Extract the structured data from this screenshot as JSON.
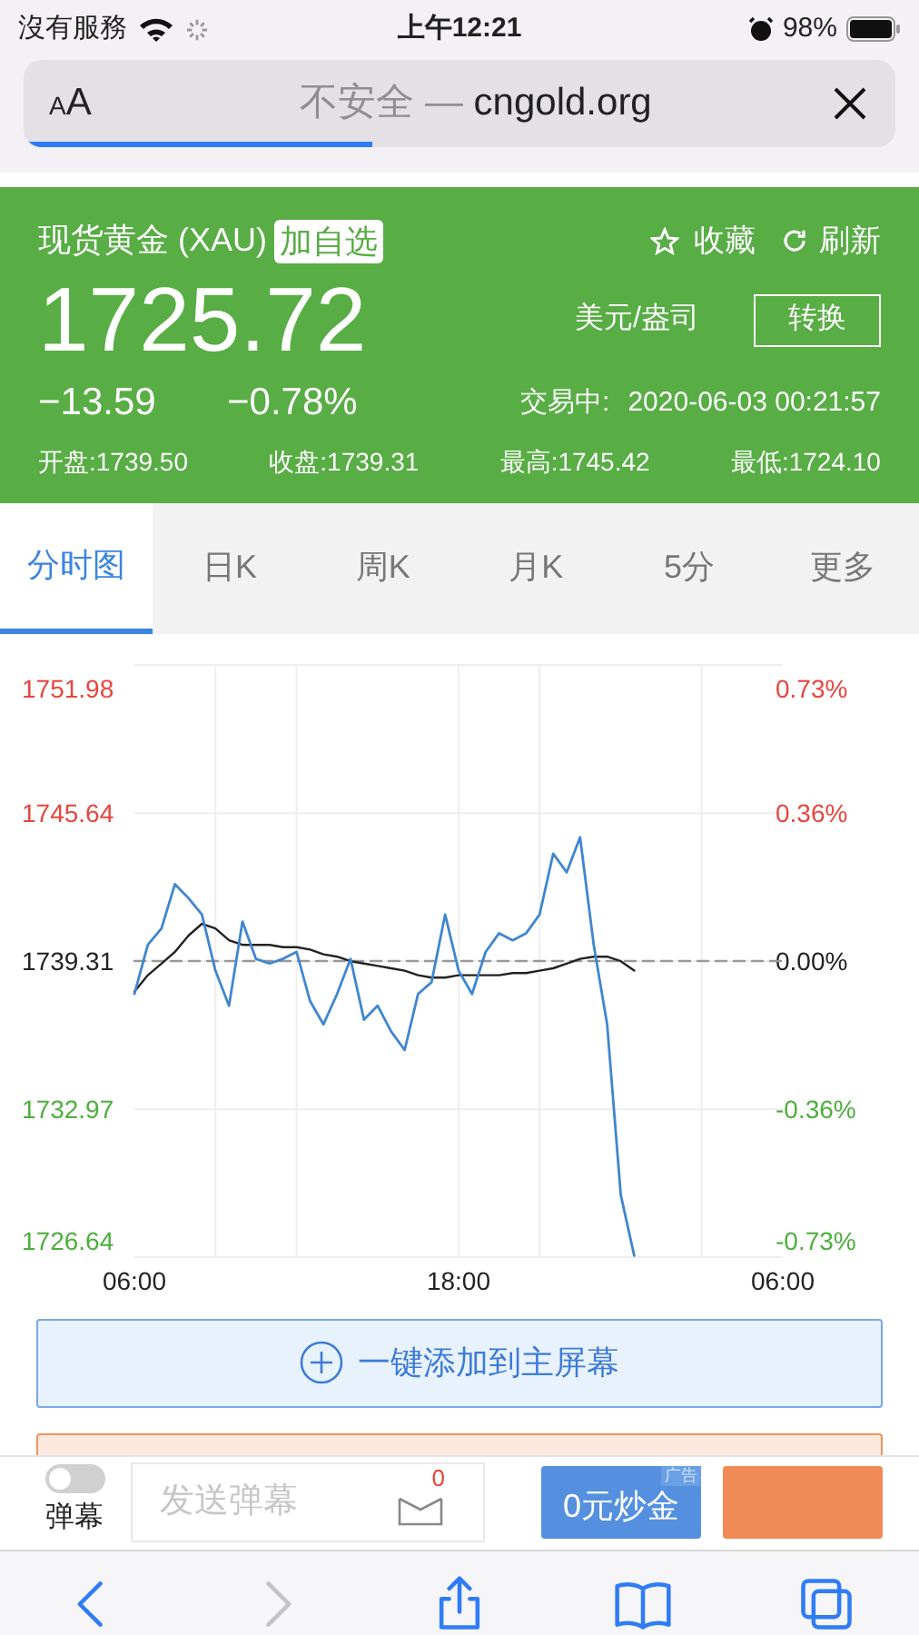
{
  "status_bar": {
    "carrier": "沒有服務",
    "time": "上午12:21",
    "battery": "98%"
  },
  "address_bar": {
    "text_size_small": "A",
    "text_size_large": "A",
    "security_note": "不安全 —",
    "domain": "cngold.org",
    "level": 0.4
  },
  "quote": {
    "name": "现货黄金 (XAU)",
    "add_watchlist": "加自选",
    "favorite": "收藏",
    "refresh": "刷新",
    "price": "1725.72",
    "unit": "美元/盎司",
    "convert": "转换",
    "change": "−13.59",
    "change_percent": "−0.78%",
    "status": "交易中:",
    "datetime": "2020-06-03 00:21:57",
    "stats": [
      {
        "label": "开盘:",
        "value": "1739.50"
      },
      {
        "label": "收盘:",
        "value": "1739.31"
      },
      {
        "label": "最高:",
        "value": "1745.42"
      },
      {
        "label": "最低:",
        "value": "1724.10"
      }
    ]
  },
  "tabs": [
    {
      "label": "分时图",
      "selected": true
    },
    {
      "label": "日K",
      "selected": false
    },
    {
      "label": "周K",
      "selected": false
    },
    {
      "label": "月K",
      "selected": false
    },
    {
      "label": "5分",
      "selected": false
    },
    {
      "label": "更多",
      "selected": false
    }
  ],
  "chart": {
    "right_labels": [
      {
        "label": "0.73%",
        "color": "#e8453c"
      },
      {
        "label": "0.36%",
        "color": "#e8453c"
      },
      {
        "label": "0.00%",
        "color": "#222222"
      },
      {
        "label": "-0.36%",
        "color": "#4caf3c"
      },
      {
        "label": "-0.73%",
        "color": "#4caf3c"
      }
    ],
    "chart_data": {
      "type": "line",
      "categories": [
        "06:00",
        null,
        null,
        null,
        null,
        null,
        null,
        null,
        null,
        null,
        null,
        null,
        null,
        null,
        null,
        null,
        null,
        null,
        null,
        null,
        null,
        null,
        null,
        null,
        "18:00",
        null,
        null,
        null,
        null,
        null,
        null,
        null,
        null,
        null,
        null,
        null,
        null,
        null,
        null,
        null,
        null,
        null,
        null,
        null,
        null,
        null,
        null,
        null,
        "06:00"
      ],
      "series": [
        {
          "color": "#3f86d0",
          "values": [
            1737.9,
            1740.0,
            1740.7,
            1742.6,
            1742.0,
            1741.3,
            1738.9,
            1737.4,
            1741.0,
            1739.4,
            1739.2,
            1739.4,
            1739.7,
            1737.6,
            1736.6,
            1737.9,
            1739.4,
            1736.8,
            1737.4,
            1736.3,
            1735.5,
            1737.9,
            1738.4,
            1741.3,
            1738.9,
            1737.9,
            1739.7,
            1740.5,
            1740.2,
            1740.5,
            1741.3,
            1743.9,
            1743.1,
            1744.6,
            1740.0,
            1736.6,
            1729.3,
            1726.7,
            null,
            null,
            null,
            null,
            null,
            null,
            null,
            null,
            null,
            null,
            null
          ]
        },
        {
          "color": "#222222",
          "values": [
            1738.0,
            1738.7,
            1739.2,
            1739.7,
            1740.4,
            1740.9,
            1740.7,
            1740.2,
            1740.0,
            1740.0,
            1740.0,
            1739.9,
            1739.9,
            1739.8,
            1739.6,
            1739.5,
            1739.3,
            1739.2,
            1739.1,
            1739.0,
            1738.9,
            1738.7,
            1738.6,
            1738.6,
            1738.7,
            1738.7,
            1738.7,
            1738.7,
            1738.8,
            1738.8,
            1738.9,
            1739.0,
            1739.2,
            1739.4,
            1739.5,
            1739.5,
            1739.3,
            1738.9,
            null,
            null,
            null,
            null,
            null,
            null,
            null,
            null,
            null,
            null,
            null
          ]
        },
        {
          "color": "#999999",
          "line_style": "dashed",
          "values": [
            1739.31,
            1739.31,
            1739.31,
            1739.31,
            1739.31,
            1739.31,
            1739.31,
            1739.31,
            1739.31,
            1739.31,
            1739.31,
            1739.31,
            1739.31,
            1739.31,
            1739.31,
            1739.31,
            1739.31,
            1739.31,
            1739.31,
            1739.31,
            1739.31,
            1739.31,
            1739.31,
            1739.31,
            1739.31,
            1739.31,
            1739.31,
            1739.31,
            1739.31,
            1739.31,
            1739.31,
            1739.31,
            1739.31,
            1739.31,
            1739.31,
            1739.31,
            1739.31,
            1739.31,
            1739.31,
            1739.31,
            1739.31,
            1739.31,
            1739.31,
            1739.31,
            1739.31,
            1739.31,
            1739.31,
            1739.31,
            1739.31
          ]
        }
      ],
      "grid": true,
      "ylim": [
        1726.64,
        1751.98
      ],
      "yticks": [
        {
          "value": 1751.98,
          "label": "1751.98"
        },
        {
          "value": 1745.64,
          "label": "1745.64"
        },
        {
          "value": 1739.31,
          "label": "1739.31"
        },
        {
          "value": 1732.97,
          "label": "1732.97"
        },
        {
          "value": 1726.64,
          "label": "1726.64"
        }
      ]
    }
  },
  "add_home_button": "一键添加到主屏幕",
  "bottom_bar": {
    "danmaku_label": "弹幕",
    "danmaku_on": false,
    "input_placeholder": "发送弹幕",
    "message_count": "0",
    "promo_button": "0元炒金",
    "ad_tag": "广告"
  },
  "browser_toolbar": [
    {
      "kind": "back",
      "disabled": false
    },
    {
      "kind": "forward",
      "disabled": true
    },
    {
      "kind": "share",
      "disabled": false
    },
    {
      "kind": "bookmarks",
      "disabled": false
    },
    {
      "kind": "tabs",
      "disabled": false
    }
  ]
}
